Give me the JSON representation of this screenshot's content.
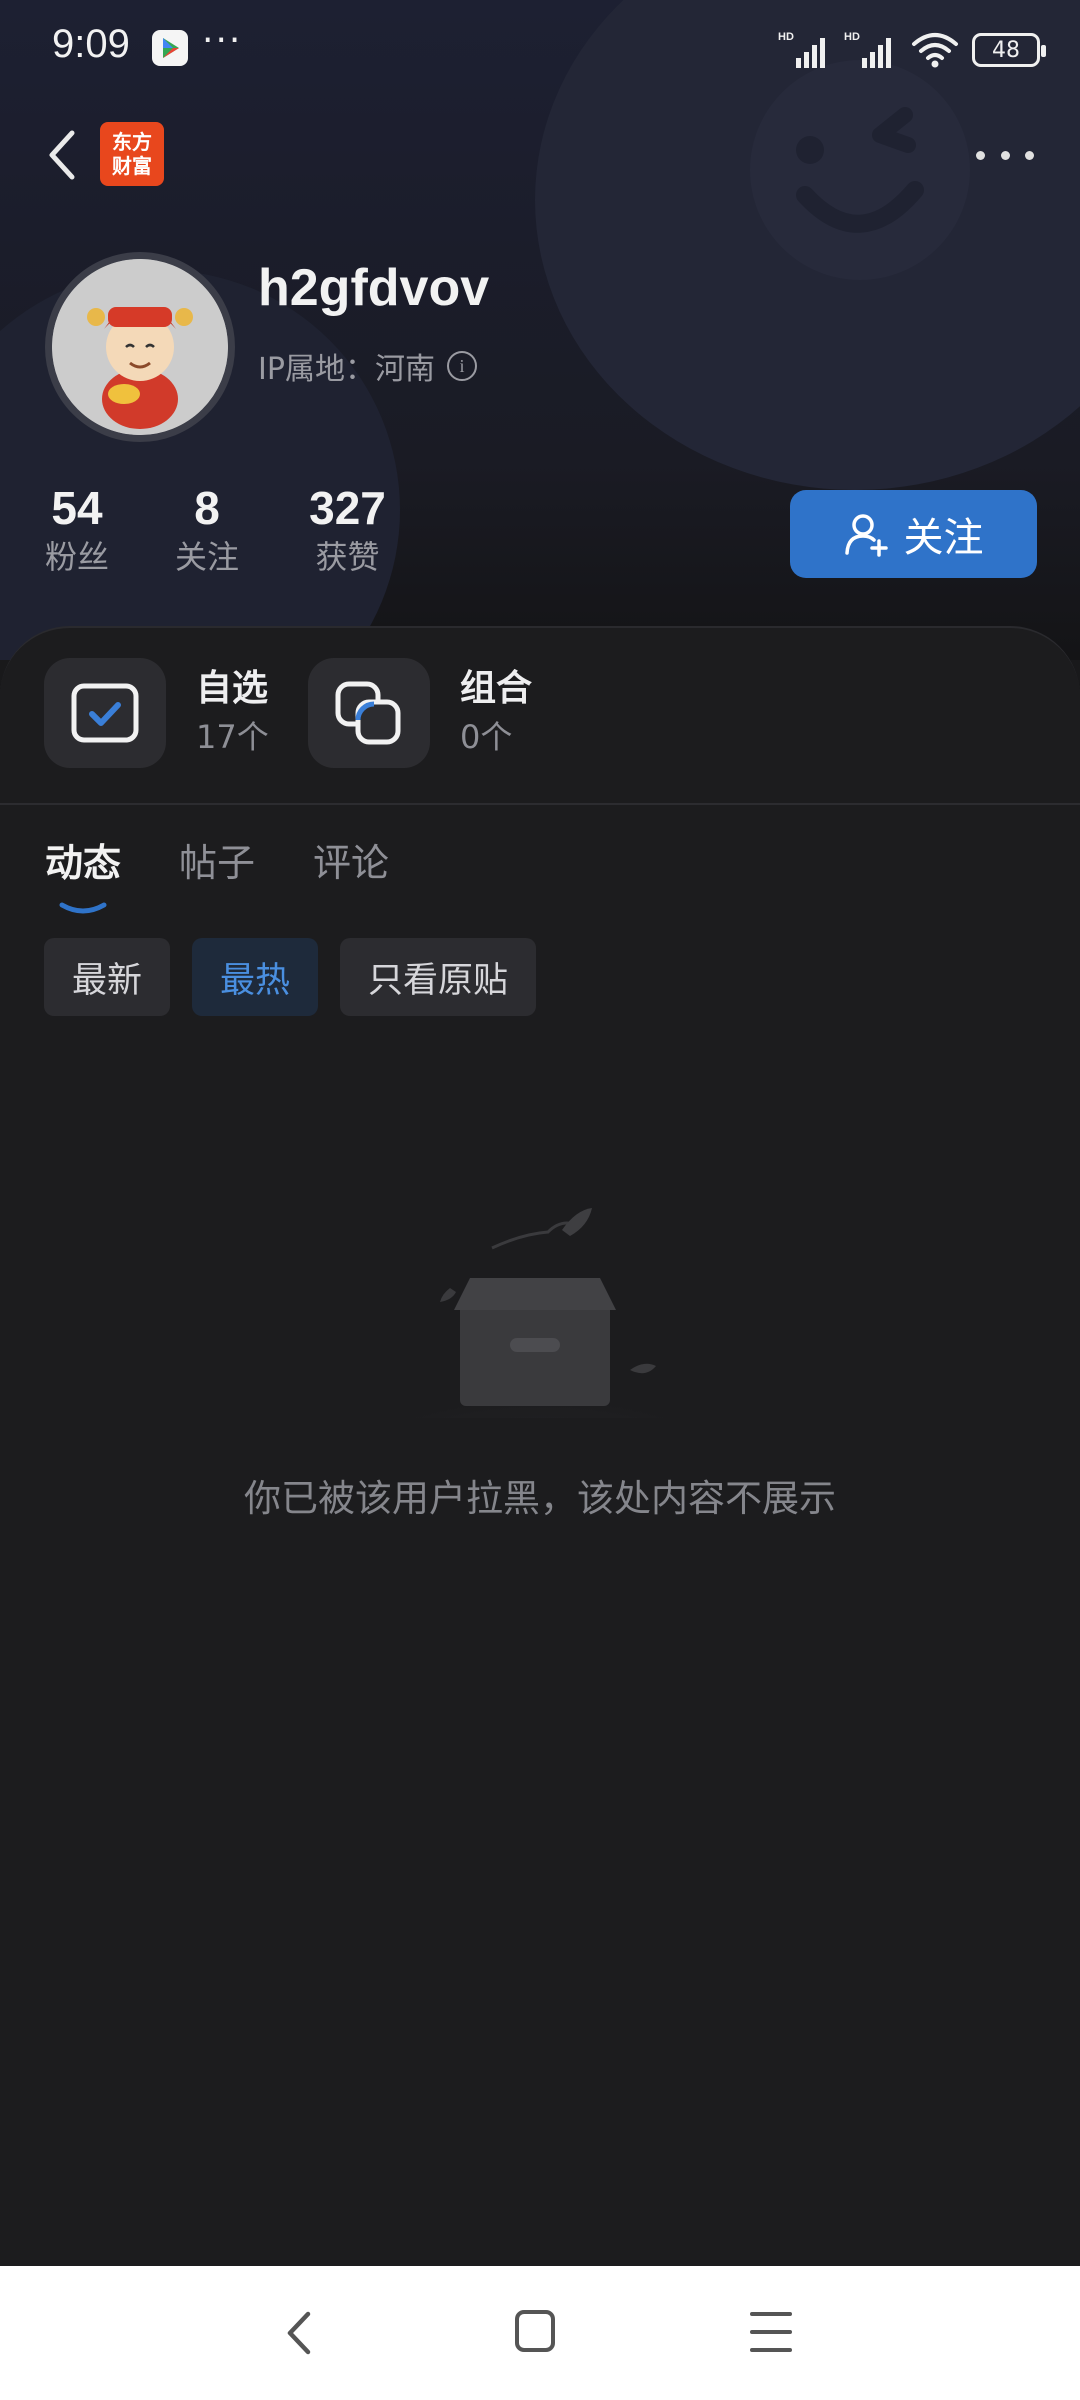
{
  "status_bar": {
    "time": "9:09",
    "more": "···",
    "battery": "48"
  },
  "header": {
    "app_logo": "东方\n财富"
  },
  "profile": {
    "username": "h2gfdvov",
    "ip_location": "IP属地：河南",
    "stats": [
      {
        "value": "54",
        "label": "粉丝"
      },
      {
        "value": "8",
        "label": "关注"
      },
      {
        "value": "327",
        "label": "获赞"
      }
    ],
    "follow_label": "关注"
  },
  "shortcuts": [
    {
      "title": "自选",
      "count": "17个"
    },
    {
      "title": "组合",
      "count": "0个"
    }
  ],
  "tabs": [
    {
      "label": "动态",
      "active": true
    },
    {
      "label": "帖子",
      "active": false
    },
    {
      "label": "评论",
      "active": false
    }
  ],
  "filters": [
    {
      "label": "最新",
      "active": false
    },
    {
      "label": "最热",
      "active": true
    },
    {
      "label": "只看原贴",
      "active": false
    }
  ],
  "empty_state": {
    "message": "你已被该用户拉黑，该处内容不展示"
  },
  "colors": {
    "accent": "#2f73c9",
    "active_chip_text": "#4a8fe0",
    "logo_bg": "#e8471d"
  }
}
